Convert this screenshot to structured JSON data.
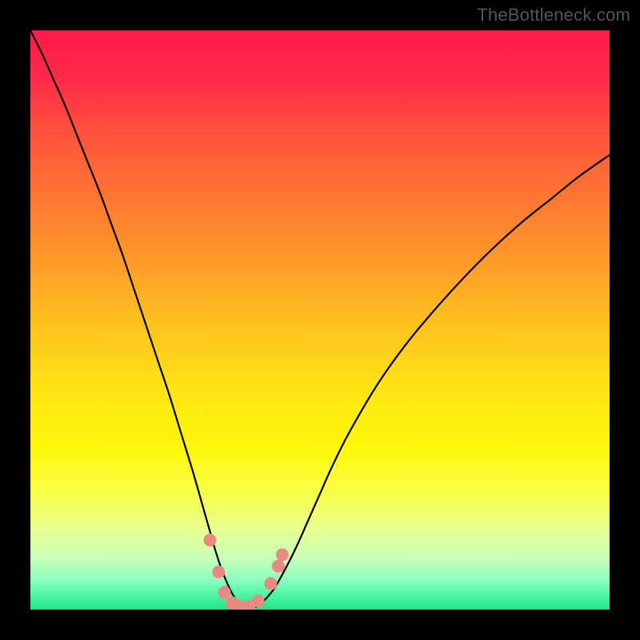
{
  "watermark": "TheBottleneck.com",
  "chart_data": {
    "type": "line",
    "title": "",
    "xlabel": "",
    "ylabel": "",
    "xlim": [
      0,
      100
    ],
    "ylim": [
      0,
      100
    ],
    "background_gradient": {
      "stops": [
        {
          "offset": 0.0,
          "color": "#ff1a4b"
        },
        {
          "offset": 0.08,
          "color": "#ff2a47"
        },
        {
          "offset": 0.2,
          "color": "#ff5a3a"
        },
        {
          "offset": 0.35,
          "color": "#ff8a2e"
        },
        {
          "offset": 0.5,
          "color": "#ffbf1f"
        },
        {
          "offset": 0.62,
          "color": "#ffe414"
        },
        {
          "offset": 0.72,
          "color": "#fff70a"
        },
        {
          "offset": 0.8,
          "color": "#f8ff4a"
        },
        {
          "offset": 0.86,
          "color": "#e8ff90"
        },
        {
          "offset": 0.91,
          "color": "#c8ffb8"
        },
        {
          "offset": 0.95,
          "color": "#8affc0"
        },
        {
          "offset": 0.975,
          "color": "#4cf5a2"
        },
        {
          "offset": 1.0,
          "color": "#1ee58a"
        }
      ]
    },
    "series": [
      {
        "name": "bottleneck-curve",
        "color": "#000000",
        "x": [
          0,
          2,
          4,
          6,
          8,
          10,
          12,
          14,
          16,
          18,
          20,
          22,
          24,
          26,
          28,
          30,
          31,
          32,
          33,
          34,
          35,
          36,
          37,
          38,
          39,
          40,
          42,
          44,
          46,
          48,
          50,
          52,
          55,
          60,
          65,
          70,
          75,
          80,
          85,
          90,
          95,
          100
        ],
        "y": [
          100,
          96,
          91.5,
          87,
          82,
          77,
          72,
          66.5,
          61,
          55,
          49,
          43,
          37,
          30.5,
          24,
          17,
          13.5,
          10,
          7,
          4.5,
          2.5,
          1.2,
          0.5,
          0.3,
          0.5,
          1.2,
          3.5,
          7,
          11,
          15.5,
          20,
          24.5,
          30.5,
          39,
          46,
          52,
          57.5,
          62.5,
          67,
          71,
          75,
          78.5
        ]
      }
    ],
    "markers": {
      "name": "highlight-points",
      "color": "#e98a82",
      "radius": 8,
      "points": [
        {
          "x": 31.0,
          "y": 12.0
        },
        {
          "x": 32.5,
          "y": 6.5
        },
        {
          "x": 33.5,
          "y": 3.0
        },
        {
          "x": 34.8,
          "y": 1.2
        },
        {
          "x": 36.2,
          "y": 0.6
        },
        {
          "x": 37.8,
          "y": 0.6
        },
        {
          "x": 39.3,
          "y": 1.5
        },
        {
          "x": 41.5,
          "y": 4.5
        },
        {
          "x": 42.8,
          "y": 7.5
        },
        {
          "x": 43.5,
          "y": 9.5
        }
      ]
    }
  }
}
